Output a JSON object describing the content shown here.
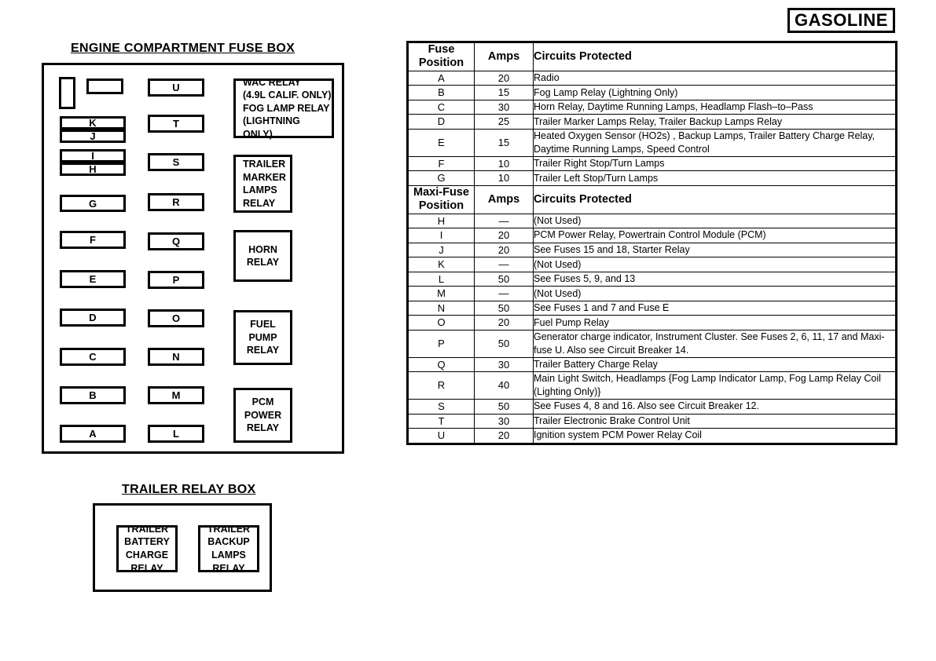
{
  "badge": {
    "label": "GASOLINE"
  },
  "diagram": {
    "fusebox_title": "ENGINE COMPARTMENT FUSE BOX",
    "trailer_title": "TRAILER RELAY BOX",
    "fuse_slots_left": [
      "K",
      "J",
      "I",
      "H",
      "G",
      "F",
      "E",
      "D",
      "C",
      "B",
      "A"
    ],
    "fuse_slots_middle": [
      "U",
      "T",
      "S",
      "R",
      "Q",
      "P",
      "O",
      "N",
      "M",
      "L"
    ],
    "relays": [
      {
        "name": "wac-relay",
        "lines": [
          "WAC RELAY",
          "(4.9L CALIF. ONLY)",
          "FOG LAMP RELAY",
          "(LIGHTNING ONLY)"
        ]
      },
      {
        "name": "trailer-marker-lamps-relay",
        "lines": [
          "TRAILER",
          "MARKER",
          "LAMPS",
          "RELAY"
        ]
      },
      {
        "name": "horn-relay",
        "lines": [
          "HORN",
          "RELAY"
        ]
      },
      {
        "name": "fuel-pump-relay",
        "lines": [
          "FUEL",
          "PUMP",
          "RELAY"
        ]
      },
      {
        "name": "pcm-power-relay",
        "lines": [
          "PCM",
          "POWER",
          "RELAY"
        ]
      }
    ],
    "trailer_relays": [
      {
        "name": "trailer-battery-charge-relay",
        "lines": [
          "TRAILER",
          "BATTERY",
          "CHARGE",
          "RELAY"
        ]
      },
      {
        "name": "trailer-backup-lamps-relay",
        "lines": [
          "TRAILER",
          "BACKUP",
          "LAMPS",
          "RELAY"
        ]
      }
    ]
  },
  "table": {
    "header_fuse": {
      "position": "Fuse Position",
      "position_line1": "Fuse",
      "position_line2": "Position",
      "amps": "Amps",
      "circuits": "Circuits Protected"
    },
    "header_maxifuse": {
      "position_line1": "Maxi-Fuse",
      "position_line2": "Position",
      "amps": "Amps",
      "circuits": "Circuits Protected"
    },
    "fuse_rows": [
      {
        "position": "A",
        "amps": "20",
        "circuits": "Radio"
      },
      {
        "position": "B",
        "amps": "15",
        "circuits": "Fog Lamp Relay (Lightning Only)"
      },
      {
        "position": "C",
        "amps": "30",
        "circuits": "Horn Relay, Daytime Running Lamps, Headlamp Flash–to–Pass"
      },
      {
        "position": "D",
        "amps": "25",
        "circuits": "Trailer Marker Lamps Relay, Trailer Backup Lamps Relay"
      },
      {
        "position": "E",
        "amps": "15",
        "circuits": "Heated Oxygen Sensor (HO2s) , Backup Lamps, Trailer Battery Charge Relay, Daytime Running Lamps, Speed Control"
      },
      {
        "position": "F",
        "amps": "10",
        "circuits": "Trailer Right Stop/Turn Lamps"
      },
      {
        "position": "G",
        "amps": "10",
        "circuits": "Trailer Left Stop/Turn Lamps"
      }
    ],
    "maxifuse_rows": [
      {
        "position": "H",
        "amps": "—",
        "circuits": "(Not Used)"
      },
      {
        "position": "I",
        "amps": "20",
        "circuits": "PCM Power Relay, Powertrain Control Module (PCM)"
      },
      {
        "position": "J",
        "amps": "20",
        "circuits": "See Fuses 15 and 18, Starter Relay"
      },
      {
        "position": "K",
        "amps": "—",
        "circuits": "(Not Used)"
      },
      {
        "position": "L",
        "amps": "50",
        "circuits": "See Fuses 5, 9, and 13"
      },
      {
        "position": "M",
        "amps": "—",
        "circuits": "(Not  Used)"
      },
      {
        "position": "N",
        "amps": "50",
        "circuits": "See Fuses 1 and 7 and Fuse E"
      },
      {
        "position": "O",
        "amps": "20",
        "circuits": "Fuel Pump Relay"
      },
      {
        "position": "P",
        "amps": "50",
        "circuits": "Generator charge indicator, Instrument Cluster.  See Fuses 2, 6, 11, 17 and Maxi-fuse U.  Also see Circuit Breaker 14."
      },
      {
        "position": "Q",
        "amps": "30",
        "circuits": "Trailer Battery Charge Relay"
      },
      {
        "position": "R",
        "amps": "40",
        "circuits": "Main Light Switch, Headlamps {Fog Lamp Indicator Lamp, Fog Lamp Relay Coil (Lighting Only)}"
      },
      {
        "position": "S",
        "amps": "50",
        "circuits": "See Fuses 4, 8 and 16. Also see Circuit Breaker 12."
      },
      {
        "position": "T",
        "amps": "30",
        "circuits": "Trailer Electronic Brake Control Unit"
      },
      {
        "position": "U",
        "amps": "20",
        "circuits": "Ignition system  PCM Power Relay Coil"
      }
    ]
  }
}
